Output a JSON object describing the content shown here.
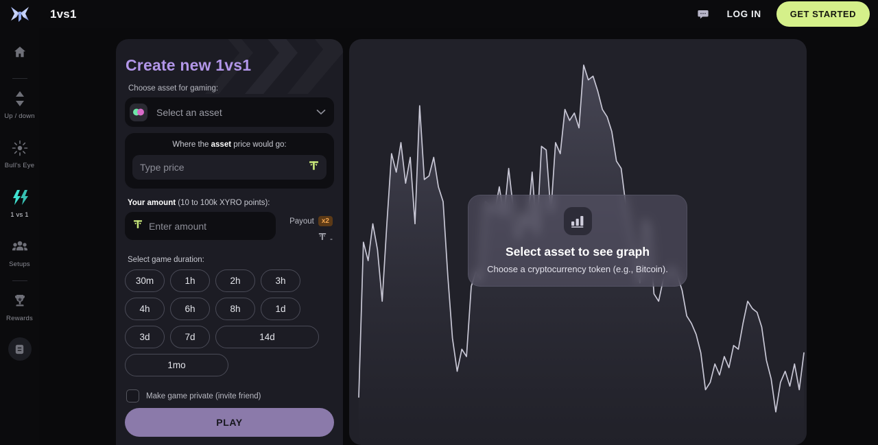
{
  "header": {
    "brand_title": "1vs1",
    "logo_icon": "xyro-x-logo",
    "chat_icon": "chat-bubble-icon",
    "login_label": "LOG IN",
    "get_started_label": "GET STARTED",
    "get_started_color": "#d5f08a"
  },
  "sidebar": {
    "items": [
      {
        "label": "",
        "icon": "home-icon",
        "active": false
      },
      {
        "label": "Up / down",
        "icon": "up-down-arrows-icon",
        "active": false
      },
      {
        "label": "Bull's Eye",
        "icon": "bulls-eye-target-icon",
        "active": false
      },
      {
        "label": "1 vs 1",
        "icon": "lightning-1vs1-icon",
        "active": true
      },
      {
        "label": "Setups",
        "icon": "users-group-icon",
        "active": false
      },
      {
        "label": "Rewards",
        "icon": "trophy-icon",
        "active": false
      }
    ],
    "doc_button_icon": "document-list-icon",
    "active_color": "#3fe0d0"
  },
  "form": {
    "title": "Create new 1vs1",
    "title_color": "#b296e8",
    "asset_label": "Choose asset for gaming:",
    "asset_placeholder": "Select an asset",
    "asset_icon": "token-pair-icon",
    "chevron_icon": "chevron-down-icon",
    "price_caption_pre": "Where the ",
    "price_caption_bold": "asset",
    "price_caption_post": " price would go:",
    "price_placeholder": "Type price",
    "price_token_icon": "xyro-token-icon",
    "amount_label_bold": "Your amount",
    "amount_label_rest": " (10 to 100k XYRO points):",
    "amount_placeholder": "Enter amount",
    "amount_token_icon": "xyro-token-icon",
    "payout_label": "Payout",
    "payout_multiplier": "x2",
    "payout_badge_color": "#f0a44e",
    "payout_value": "-",
    "duration_label": "Select game duration:",
    "durations": [
      "30m",
      "1h",
      "2h",
      "3h",
      "4h",
      "6h",
      "8h",
      "1d",
      "3d",
      "7d",
      "14d",
      "1mo"
    ],
    "private_label": "Make game private (invite friend)",
    "private_checked": false,
    "play_label": "PLAY",
    "play_color": "#8b7aaa"
  },
  "chart": {
    "overlay_icon": "bar-chart-icon",
    "overlay_title": "Select asset to see graph",
    "overlay_subtitle": "Choose a cryptocurrency token (e.g., Bitcoin)."
  },
  "chart_data": {
    "type": "line",
    "title": "",
    "xlabel": "",
    "ylabel": "",
    "grid": false,
    "legend": null,
    "line_color": "#c9c8d6",
    "fill": "gradient-violet-fade",
    "x": [
      0,
      1,
      2,
      3,
      4,
      5,
      6,
      7,
      8,
      9,
      10,
      11,
      12,
      13,
      14,
      15,
      16,
      17,
      18,
      19,
      20,
      21,
      22,
      23,
      24,
      25,
      26,
      27,
      28,
      29,
      30,
      31,
      32,
      33,
      34,
      35,
      36,
      37,
      38,
      39,
      40,
      41,
      42,
      43,
      44,
      45,
      46,
      47,
      48,
      49,
      50,
      51,
      52,
      53,
      54,
      55,
      56,
      57,
      58,
      59,
      60,
      61,
      62,
      63,
      64,
      65,
      66,
      67,
      68,
      69,
      70,
      71,
      72,
      73,
      74,
      75,
      76,
      77,
      78,
      79,
      80,
      81,
      82,
      83,
      84,
      85,
      86,
      87,
      88,
      89,
      90,
      91,
      92,
      93,
      94,
      95
    ],
    "values": [
      10,
      52,
      47,
      57,
      50,
      36,
      57,
      76,
      71,
      79,
      68,
      75,
      57,
      89,
      69,
      70,
      75,
      67,
      63,
      43,
      26,
      17,
      23,
      21,
      40,
      44,
      42,
      63,
      62,
      60,
      67,
      59,
      72,
      61,
      53,
      60,
      56,
      71,
      54,
      78,
      77,
      60,
      79,
      76,
      88,
      85,
      87,
      83,
      100,
      96,
      97,
      93,
      88,
      86,
      82,
      74,
      72,
      62,
      55,
      47,
      41,
      58,
      56,
      38,
      36,
      42,
      44,
      45,
      43,
      39,
      32,
      30,
      27,
      22,
      12,
      14,
      19,
      16,
      21,
      18,
      24,
      23,
      30,
      36,
      34,
      33,
      29,
      20,
      15,
      6,
      14,
      17,
      13,
      19,
      12,
      22
    ],
    "ylim": [
      0,
      100
    ]
  }
}
